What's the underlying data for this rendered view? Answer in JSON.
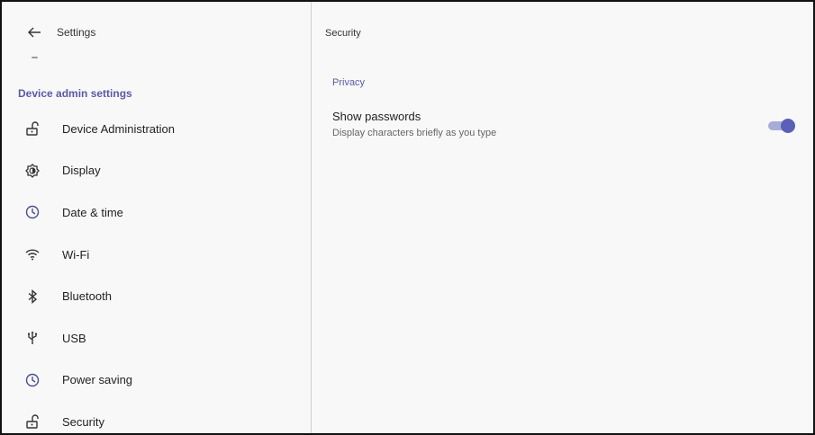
{
  "header": {
    "title": "Settings"
  },
  "sidebar": {
    "section_title": "Device admin settings",
    "items": [
      {
        "label": "Device Administration",
        "icon": "unlock-icon"
      },
      {
        "label": "Display",
        "icon": "brightness-icon"
      },
      {
        "label": "Date & time",
        "icon": "clock-icon"
      },
      {
        "label": "Wi-Fi",
        "icon": "wifi-icon"
      },
      {
        "label": "Bluetooth",
        "icon": "bluetooth-icon"
      },
      {
        "label": "USB",
        "icon": "usb-icon"
      },
      {
        "label": "Power saving",
        "icon": "clock-icon"
      },
      {
        "label": "Security",
        "icon": "unlock-icon"
      }
    ]
  },
  "main": {
    "title": "Security",
    "category": "Privacy",
    "preference": {
      "title": "Show passwords",
      "summary": "Display characters briefly as you type",
      "enabled": true
    }
  },
  "colors": {
    "accent": "#5a5aa6",
    "toggle_thumb": "#5a60b8",
    "toggle_track": "#a9acd8",
    "background": "#f8f8f8"
  }
}
